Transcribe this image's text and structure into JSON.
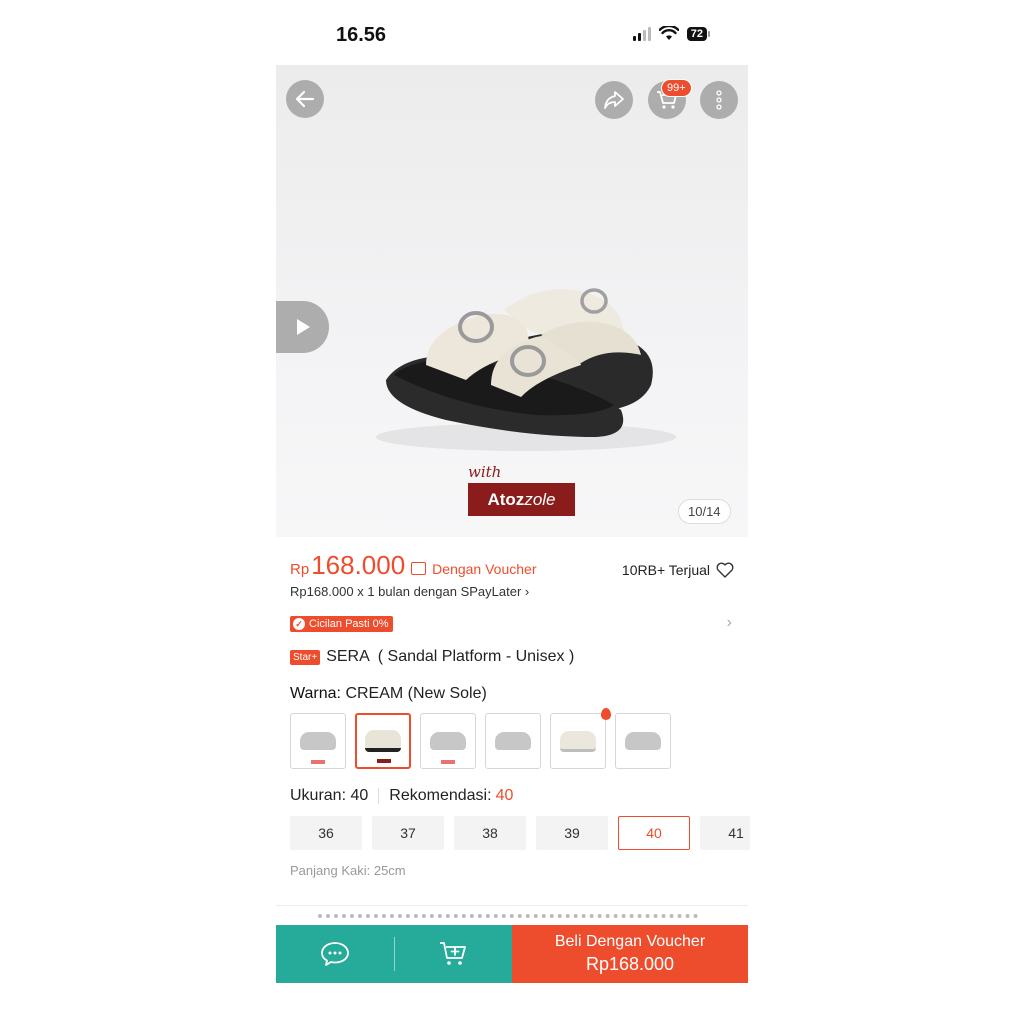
{
  "status_bar": {
    "time": "16.56",
    "battery": "72"
  },
  "gallery": {
    "counter": "10/14",
    "cart_badge": "99+"
  },
  "brand": {
    "with": "with",
    "logo_bold": "Atoz",
    "logo_italic": "zole"
  },
  "product": {
    "currency": "Rp",
    "price": "168.000",
    "voucher_label": "Dengan Voucher",
    "sold": "10RB+ Terjual",
    "installment": "Rp168.000 x 1 bulan dengan SPayLater",
    "cicilan": "Cicilan Pasti 0%",
    "badge": "Star+",
    "name": "SERA  ( Sandal Platform - Unisex )"
  },
  "variant": {
    "color_label": "Warna:",
    "color_value": "CREAM (New Sole)"
  },
  "size": {
    "label": "Ukuran:",
    "value": "40",
    "rec_label": "Rekomendasi:",
    "rec_value": "40",
    "options": [
      "36",
      "37",
      "38",
      "39",
      "40",
      "41"
    ],
    "foot_length": "Panjang Kaki: 25cm"
  },
  "bottom": {
    "buy_label": "Beli Dengan Voucher",
    "buy_price": "Rp168.000"
  },
  "colors": {
    "accent": "#ee4d2d",
    "chat_bar": "#26aa99"
  }
}
